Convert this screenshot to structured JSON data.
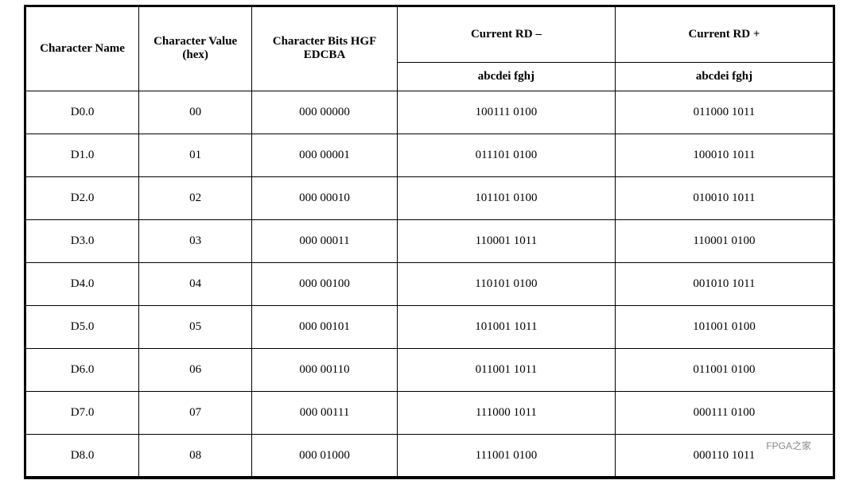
{
  "table": {
    "headers": {
      "char_name": "Character Name",
      "char_value": "Character Value (hex)",
      "char_bits": "Character Bits HGF EDCBA",
      "current_rd_minus": "Current RD –",
      "current_rd_plus": "Current RD +",
      "subheader_rd_minus": "abcdei fghj",
      "subheader_rd_plus": "abcdei fghj"
    },
    "rows": [
      {
        "name": "D0.0",
        "value": "00",
        "bits": "000 00000",
        "rd_minus": "100111 0100",
        "rd_plus": "011000 1011"
      },
      {
        "name": "D1.0",
        "value": "01",
        "bits": "000 00001",
        "rd_minus": "011101 0100",
        "rd_plus": "100010 1011"
      },
      {
        "name": "D2.0",
        "value": "02",
        "bits": "000 00010",
        "rd_minus": "101101 0100",
        "rd_plus": "010010 1011"
      },
      {
        "name": "D3.0",
        "value": "03",
        "bits": "000 00011",
        "rd_minus": "110001 1011",
        "rd_plus": "110001 0100"
      },
      {
        "name": "D4.0",
        "value": "04",
        "bits": "000 00100",
        "rd_minus": "110101 0100",
        "rd_plus": "001010 1011"
      },
      {
        "name": "D5.0",
        "value": "05",
        "bits": "000 00101",
        "rd_minus": "101001 1011",
        "rd_plus": "101001 0100"
      },
      {
        "name": "D6.0",
        "value": "06",
        "bits": "000 00110",
        "rd_minus": "011001 1011",
        "rd_plus": "011001 0100"
      },
      {
        "name": "D7.0",
        "value": "07",
        "bits": "000 00111",
        "rd_minus": "111000 1011",
        "rd_plus": "000111 0100"
      },
      {
        "name": "D8.0",
        "value": "08",
        "bits": "000 01000",
        "rd_minus": "111001 0100",
        "rd_plus": "000110 1011"
      }
    ],
    "watermark": "FPGA之家"
  }
}
